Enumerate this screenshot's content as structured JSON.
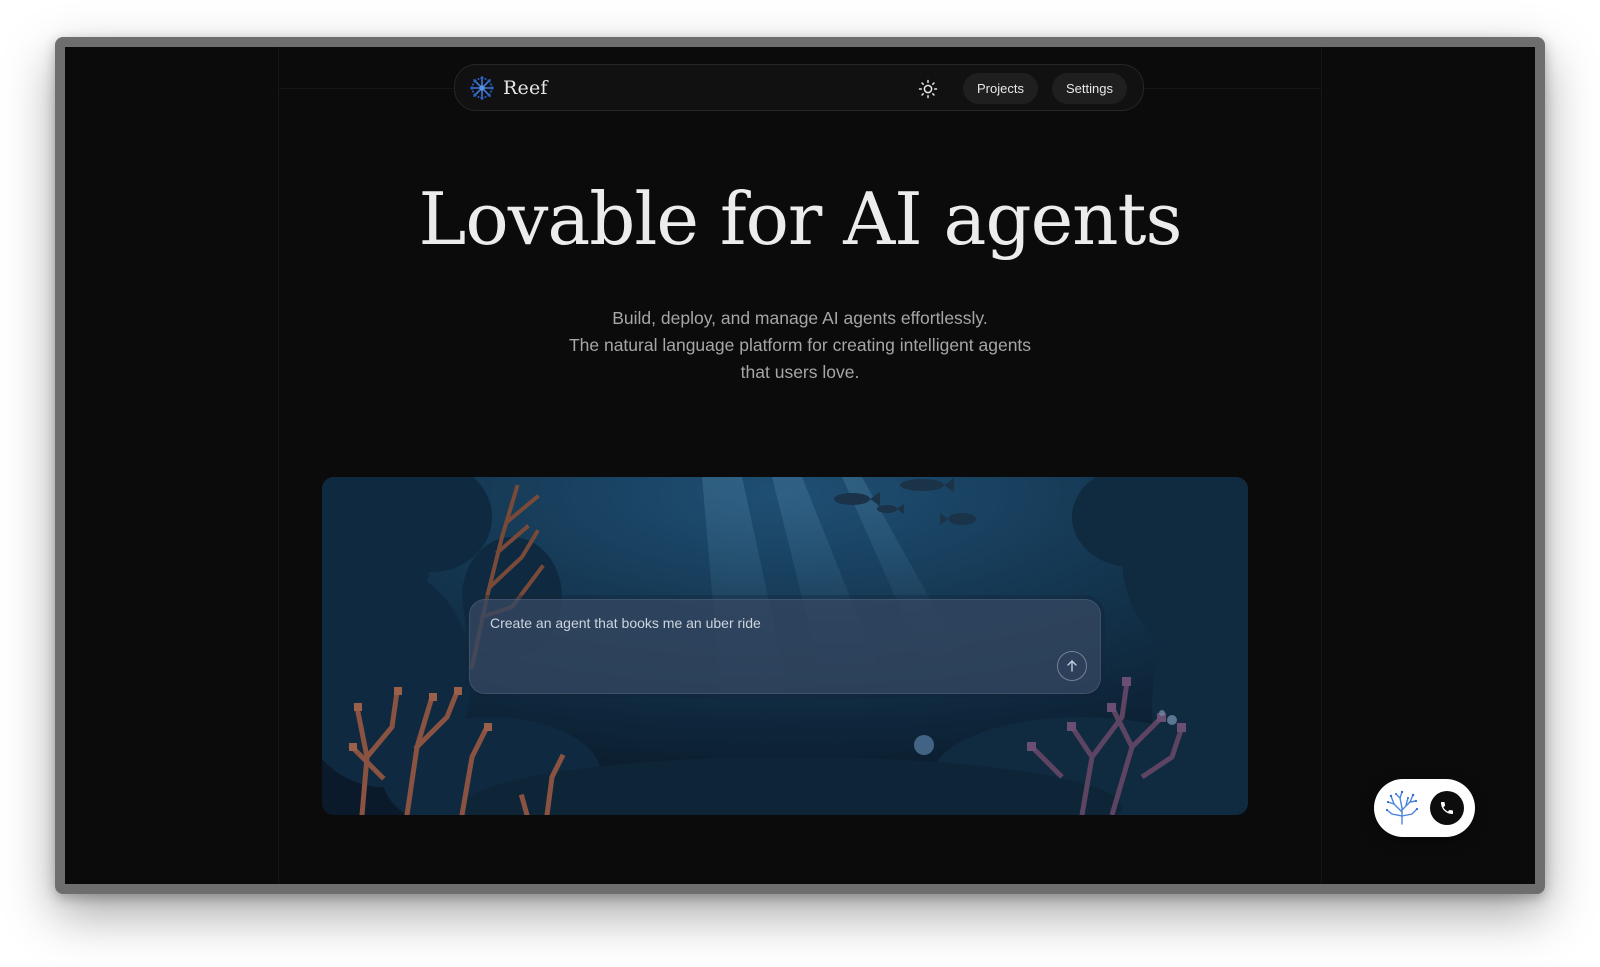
{
  "nav": {
    "brand": "Reef",
    "theme_toggle_icon": "sun-icon",
    "projects_label": "Projects",
    "settings_label": "Settings"
  },
  "hero": {
    "title": "Lovable for AI agents",
    "subtitle_lines": [
      "Build, deploy, and manage AI agents effortlessly.",
      "The natural language platform for creating intelligent agents",
      "that users love."
    ]
  },
  "prompt": {
    "text": "Create an agent that books me an uber ride",
    "send_icon": "arrow-up-icon"
  },
  "call_widget": {
    "logo_icon": "coral-icon",
    "call_icon": "phone-icon"
  },
  "colors": {
    "background": "#0b0b0b",
    "accent_blue": "#3b6fd8",
    "ocean_deep": "#0c2235"
  }
}
